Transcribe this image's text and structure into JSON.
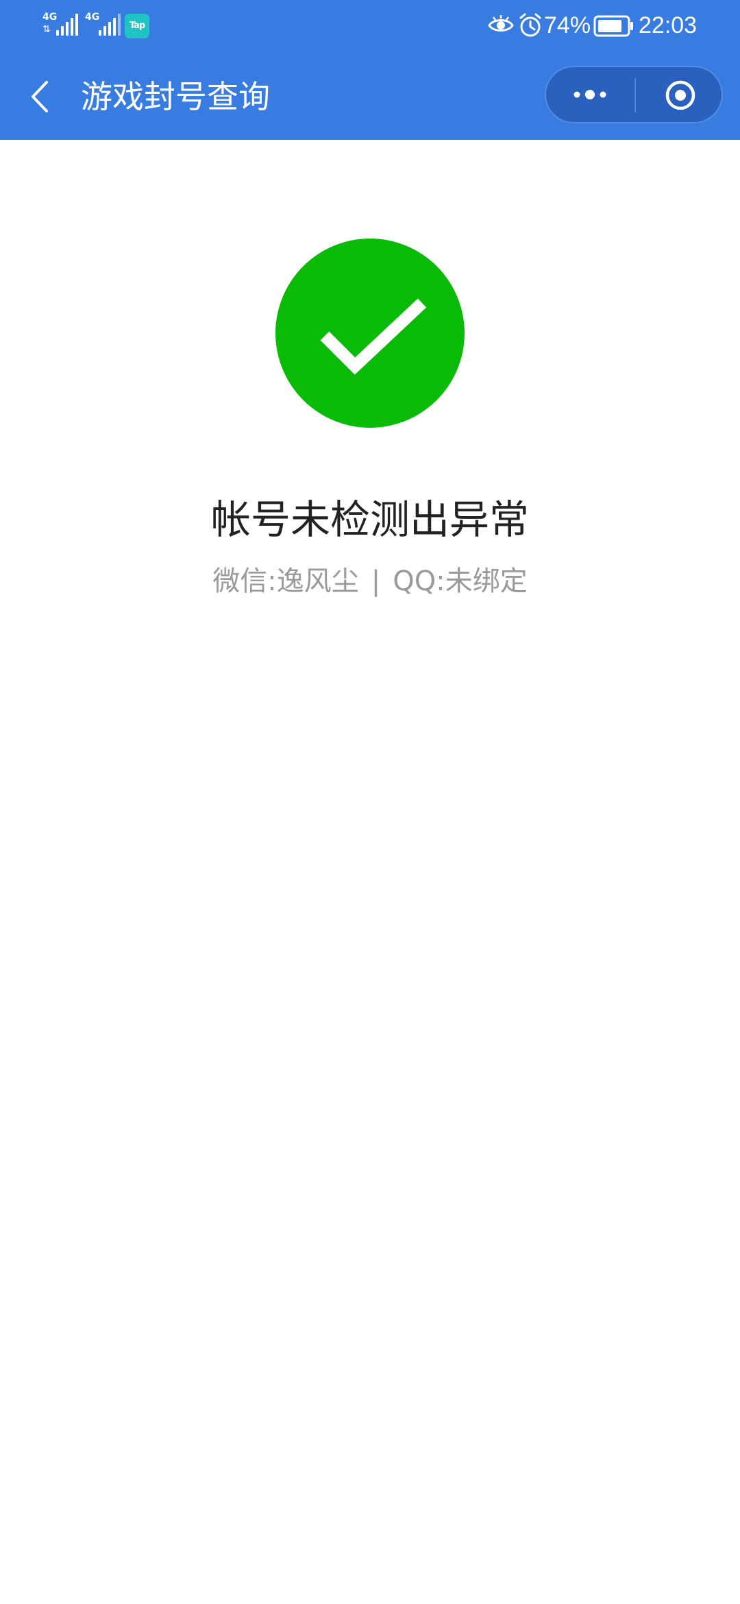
{
  "status_bar": {
    "signal1_network": "4G",
    "signal2_network": "4G",
    "tap_app_label": "Tap",
    "battery_percent": "74%",
    "time": "22:03"
  },
  "nav": {
    "title": "游戏封号查询"
  },
  "result": {
    "title": "帐号未检测出异常",
    "wechat_label": "微信:逸风尘",
    "separator": "|",
    "qq_label": "QQ:未绑定"
  },
  "colors": {
    "header_bg": "#387ce1",
    "success_green": "#09bb07",
    "title_text": "#222222",
    "sub_text": "#9a9a9a"
  },
  "icons": {
    "back": "chevron-left-icon",
    "more": "more-dots-icon",
    "close": "target-circle-icon",
    "success": "check-circle-icon",
    "eye": "eye-icon",
    "alarm": "alarm-icon",
    "battery": "battery-icon"
  }
}
